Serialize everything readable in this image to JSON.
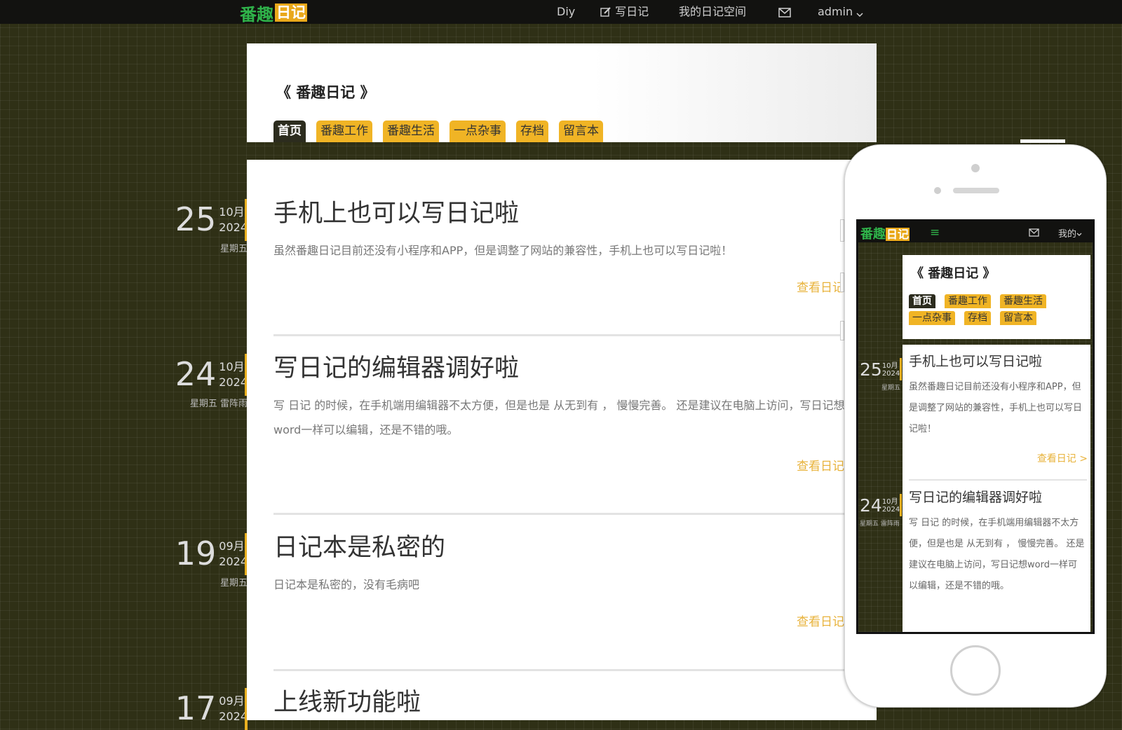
{
  "topbar": {
    "logo_green": "番趣",
    "logo_yellow": "日记",
    "nav": [
      "Diy",
      "写日记",
      "我的日记空间",
      "admin"
    ]
  },
  "blog": {
    "title": "《 番趣日记 》",
    "tabs": [
      "首页",
      "番趣工作",
      "番趣生活",
      "一点杂事",
      "存档",
      "留言本"
    ]
  },
  "posts": [
    {
      "day": "25",
      "month": "10月",
      "year": "2024",
      "weekday": "星期五",
      "title": "手机上也可以写日记啦",
      "body": "虽然番趣日记目前还没有小程序和APP，但是调整了网站的兼容性，手机上也可以写日记啦！",
      "more": "查看日记"
    },
    {
      "day": "24",
      "month": "10月",
      "year": "2024",
      "weekday": "星期五 雷阵雨",
      "title": "写日记的编辑器调好啦",
      "body": "写 日记 的时候，在手机端用编辑器不太方便，但是也是 从无到有 ， 慢慢完善。 还是建议在电脑上访问，写日记想word一样可以编辑，还是不错的哦。",
      "more": "查看日记"
    },
    {
      "day": "19",
      "month": "09月",
      "year": "2024",
      "weekday": "星期五",
      "title": "日记本是私密的",
      "body": "日记本是私密的，没有毛病吧",
      "more": "查看日记"
    },
    {
      "day": "17",
      "month": "09月",
      "year": "2024",
      "title": "上线新功能啦"
    }
  ],
  "mobile": {
    "logo_green": "番趣",
    "logo_yellow": "日记",
    "menu_icon": "≡",
    "user": "我的",
    "title": "《 番趣日记 》",
    "tabs": [
      "首页",
      "番趣工作",
      "番趣生活",
      "一点杂事",
      "存档",
      "留言本"
    ],
    "posts": [
      {
        "day": "25",
        "month": "10月",
        "year": "2024",
        "weekday": "星期五",
        "title": "手机上也可以写日记啦",
        "body": "虽然番趣日记目前还没有小程序和APP，但是调整了网站的兼容性，手机上也可以写日记啦！",
        "more": "查看日记 >"
      },
      {
        "day": "24",
        "month": "10月",
        "year": "2024",
        "weekday": "星期五 雷阵雨",
        "title": "写日记的编辑器调好啦",
        "body": "写 日记 的时候，在手机端用编辑器不太方便，但是也是 从无到有 ， 慢慢完善。 还是建议在电脑上访问，写日记想word一样可以编辑，还是不错的哦。"
      }
    ]
  },
  "colors": {
    "accent": "#f0b425",
    "brand_green": "#2fb34a",
    "dark": "#2c2c1e"
  }
}
